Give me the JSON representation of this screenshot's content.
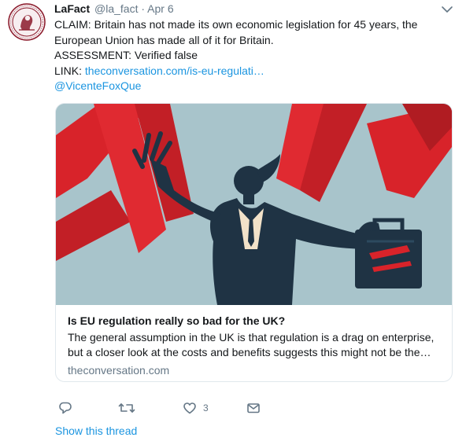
{
  "tweet": {
    "author_name": "LaFact",
    "author_handle": "@la_fact",
    "separator": "·",
    "timestamp": "Apr 6",
    "text_lines": [
      "CLAIM: Britain has not made its own economic legislation for 45 years, the",
      "European Union has made all of it for Britain.",
      "ASSESSMENT: Verified false"
    ],
    "link_prefix": "LINK: ",
    "link_text": "theconversation.com/is-eu-regulati…",
    "mention": "@VicenteFoxQue"
  },
  "card": {
    "title": "Is EU regulation really so bad for the UK?",
    "description_lines": [
      "The general assumption in the UK is that regulation is a drag on enterprise,",
      "but a closer look at the costs and benefits suggests this might not be the…"
    ],
    "domain": "theconversation.com",
    "image_icon": "businesswoman-red-tape-illustration",
    "colors": {
      "background": "#a8c4cb",
      "red": "#d8232a",
      "figure": "#1f3344"
    }
  },
  "actions": {
    "reply_icon": "reply-icon",
    "retweet_icon": "retweet-icon",
    "like_icon": "like-icon",
    "like_count": "3",
    "message_icon": "direct-message-icon"
  },
  "show_thread": "Show this thread",
  "colors": {
    "link": "#1b95e0",
    "muted": "#657786",
    "text": "#14171a"
  }
}
